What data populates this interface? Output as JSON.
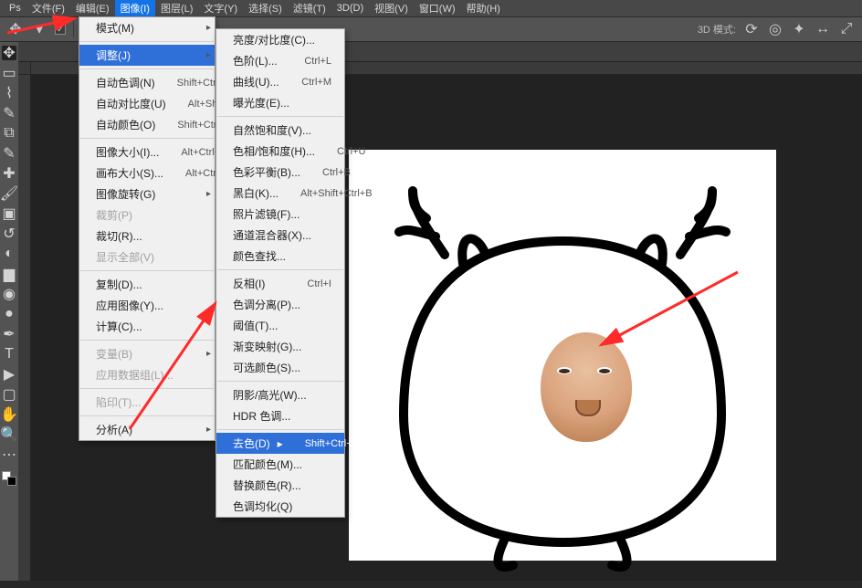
{
  "menubar": {
    "items": [
      "文件(F)",
      "编辑(E)",
      "图像(I)",
      "图层(L)",
      "文字(Y)",
      "选择(S)",
      "滤镜(T)",
      "3D(D)",
      "视图(V)",
      "窗口(W)",
      "帮助(H)"
    ],
    "active_index": 2
  },
  "toolbar": {
    "threeD_label": "3D 模式:"
  },
  "image_menu": {
    "mode": "模式(M)",
    "adjust": "调整(J)",
    "auto_tone": {
      "label": "自动色调(N)",
      "short": "Shift+Ctrl+L"
    },
    "auto_contrast": {
      "label": "自动对比度(U)",
      "short": "Alt+Shift+Ctrl+L"
    },
    "auto_color": {
      "label": "自动颜色(O)",
      "short": "Shift+Ctrl+B"
    },
    "image_size": {
      "label": "图像大小(I)...",
      "short": "Alt+Ctrl+I"
    },
    "canvas_size": {
      "label": "画布大小(S)...",
      "short": "Alt+Ctrl+C"
    },
    "image_rotation": "图像旋转(G)",
    "crop": "裁剪(P)",
    "trim": "裁切(R)...",
    "reveal_all": "显示全部(V)",
    "duplicate": "复制(D)...",
    "apply_image": "应用图像(Y)...",
    "calculations": "计算(C)...",
    "variables": "变量(B)",
    "datasets": "应用数据组(L)...",
    "trap": "陷印(T)...",
    "analysis": "分析(A)"
  },
  "adjust_menu": {
    "brightness": "亮度/对比度(C)...",
    "levels": {
      "label": "色阶(L)...",
      "short": "Ctrl+L"
    },
    "curves": {
      "label": "曲线(U)...",
      "short": "Ctrl+M"
    },
    "exposure": "曝光度(E)...",
    "vibrance": "自然饱和度(V)...",
    "hue": {
      "label": "色相/饱和度(H)...",
      "short": "Ctrl+U"
    },
    "color_balance": {
      "label": "色彩平衡(B)...",
      "short": "Ctrl+B"
    },
    "bw": {
      "label": "黑白(K)...",
      "short": "Alt+Shift+Ctrl+B"
    },
    "photo_filter": "照片滤镜(F)...",
    "channel_mixer": "通道混合器(X)...",
    "color_lookup": "颜色查找...",
    "invert": {
      "label": "反相(I)",
      "short": "Ctrl+I"
    },
    "posterize": "色调分离(P)...",
    "threshold": "阈值(T)...",
    "gradient_map": "渐变映射(G)...",
    "selective_color": "可选颜色(S)...",
    "shadows": "阴影/高光(W)...",
    "hdr": "HDR 色调...",
    "desaturate": {
      "label": "去色(D)",
      "short": "Shift+Ctrl+U"
    },
    "match_color": "匹配颜色(M)...",
    "replace_color": "替换颜色(R)...",
    "equalize": "色调均化(Q)"
  }
}
